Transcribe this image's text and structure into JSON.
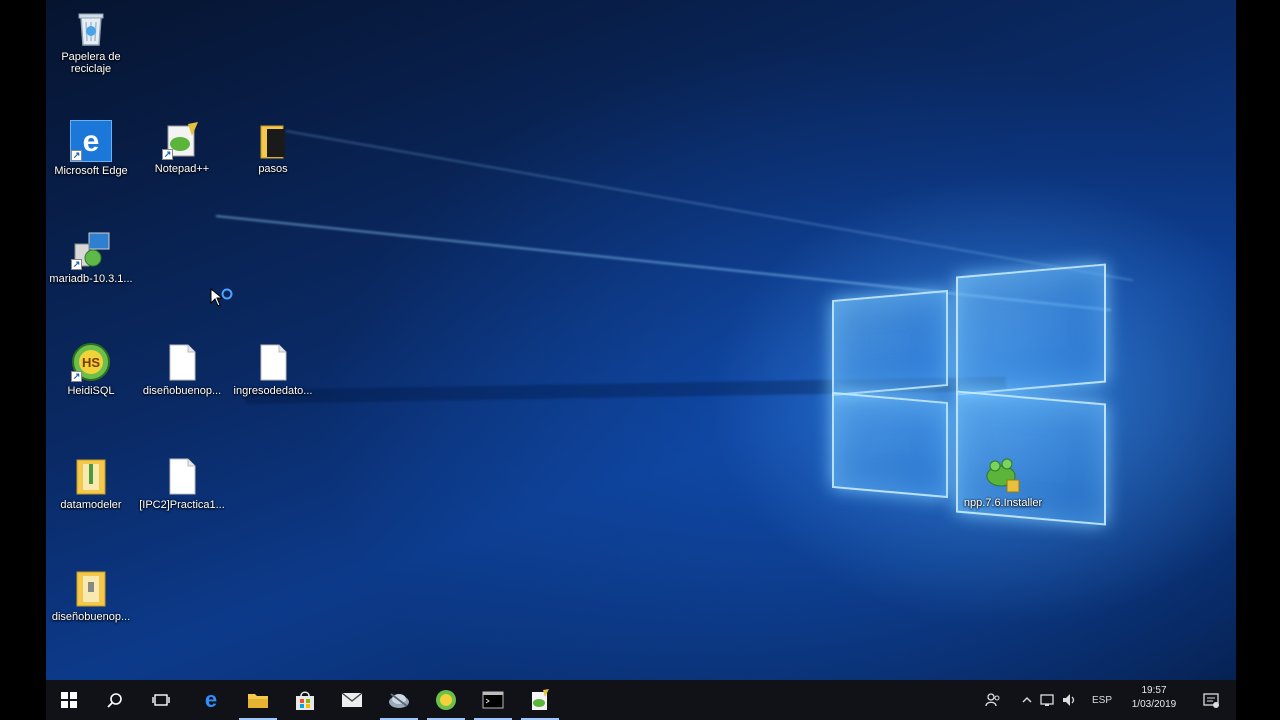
{
  "desktop": {
    "icons": [
      {
        "id": "recycle",
        "label": "Papelera de reciclaje",
        "icon": "recycle-bin-icon"
      },
      {
        "id": "edge",
        "label": "Microsoft Edge",
        "icon": "edge-icon"
      },
      {
        "id": "notepadpp",
        "label": "Notepad++",
        "icon": "notepad-plus-plus-icon"
      },
      {
        "id": "pasos",
        "label": "pasos",
        "icon": "folder-icon"
      },
      {
        "id": "mariadb",
        "label": "mariadb-10.3.1...",
        "icon": "installer-icon"
      },
      {
        "id": "heidisql",
        "label": "HeidiSQL",
        "icon": "heidisql-icon"
      },
      {
        "id": "disenobueno1",
        "label": "diseñobuenop...",
        "icon": "file-icon"
      },
      {
        "id": "ingresodatos",
        "label": "ingresodedato...",
        "icon": "file-icon"
      },
      {
        "id": "datamodeler",
        "label": "datamodeler",
        "icon": "zip-folder-icon"
      },
      {
        "id": "ipc2practica",
        "label": "[IPC2]Practica1...",
        "icon": "file-icon"
      },
      {
        "id": "disenobueno2",
        "label": "diseñobuenop...",
        "icon": "zip-folder-icon"
      },
      {
        "id": "nppinstaller",
        "label": "npp.7.6.Installer",
        "icon": "npp-installer-icon"
      }
    ]
  },
  "taskbar": {
    "buttons": [
      {
        "name": "start",
        "icon": "windows-start-icon"
      },
      {
        "name": "search",
        "icon": "search-icon"
      },
      {
        "name": "task-view",
        "icon": "task-view-icon"
      },
      {
        "name": "edge",
        "icon": "edge-icon"
      },
      {
        "name": "file-explorer",
        "icon": "folder-icon"
      },
      {
        "name": "store",
        "icon": "store-bag-icon"
      },
      {
        "name": "mail",
        "icon": "mail-icon"
      },
      {
        "name": "app-7",
        "icon": "network-app-icon"
      },
      {
        "name": "heidisql",
        "icon": "heidisql-icon"
      },
      {
        "name": "terminal",
        "icon": "terminal-icon"
      },
      {
        "name": "notepadpp",
        "icon": "notepad-plus-plus-icon"
      }
    ],
    "tray": {
      "language": "ESP",
      "time": "19:57",
      "date": "1/03/2019"
    }
  },
  "colors": {
    "taskbar": "#101218",
    "accent": "#1a8fff",
    "folder": "#f3c84b"
  }
}
